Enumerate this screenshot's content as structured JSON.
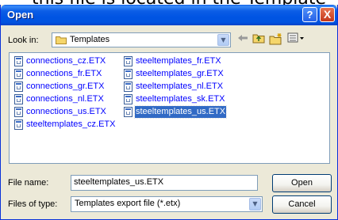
{
  "dialog": {
    "title": "Open",
    "help_label": "?",
    "close_label": "X"
  },
  "look_in": {
    "label": "Look in:",
    "value": "Templates"
  },
  "toolbar": {
    "back_icon": "back-arrow-icon",
    "up_icon": "up-one-level-icon",
    "new_folder_icon": "new-folder-icon",
    "views_icon": "views-menu-icon"
  },
  "files": {
    "column1": [
      {
        "name": "connections_cz.ETX"
      },
      {
        "name": "connections_fr.ETX"
      },
      {
        "name": "connections_gr.ETX"
      },
      {
        "name": "connections_nl.ETX"
      },
      {
        "name": "connections_us.ETX"
      },
      {
        "name": "steeltemplates_cz.ETX"
      }
    ],
    "column2": [
      {
        "name": "steeltemplates_fr.ETX"
      },
      {
        "name": "steeltemplates_gr.ETX"
      },
      {
        "name": "steeltemplates_nl.ETX"
      },
      {
        "name": "steeltemplates_sk.ETX"
      },
      {
        "name": "steeltemplates_us.ETX",
        "selected": true
      }
    ]
  },
  "file_name": {
    "label": "File name:",
    "value": "steeltemplates_us.ETX"
  },
  "file_type": {
    "label": "Files of type:",
    "value": "Templates export file (*.etx)"
  },
  "buttons": {
    "open": "Open",
    "cancel": "Cancel"
  },
  "colors": {
    "titlebar": "#0054e3",
    "dialog_bg": "#ece9d8",
    "selection": "#316ac5",
    "link_text": "#0000ff"
  }
}
